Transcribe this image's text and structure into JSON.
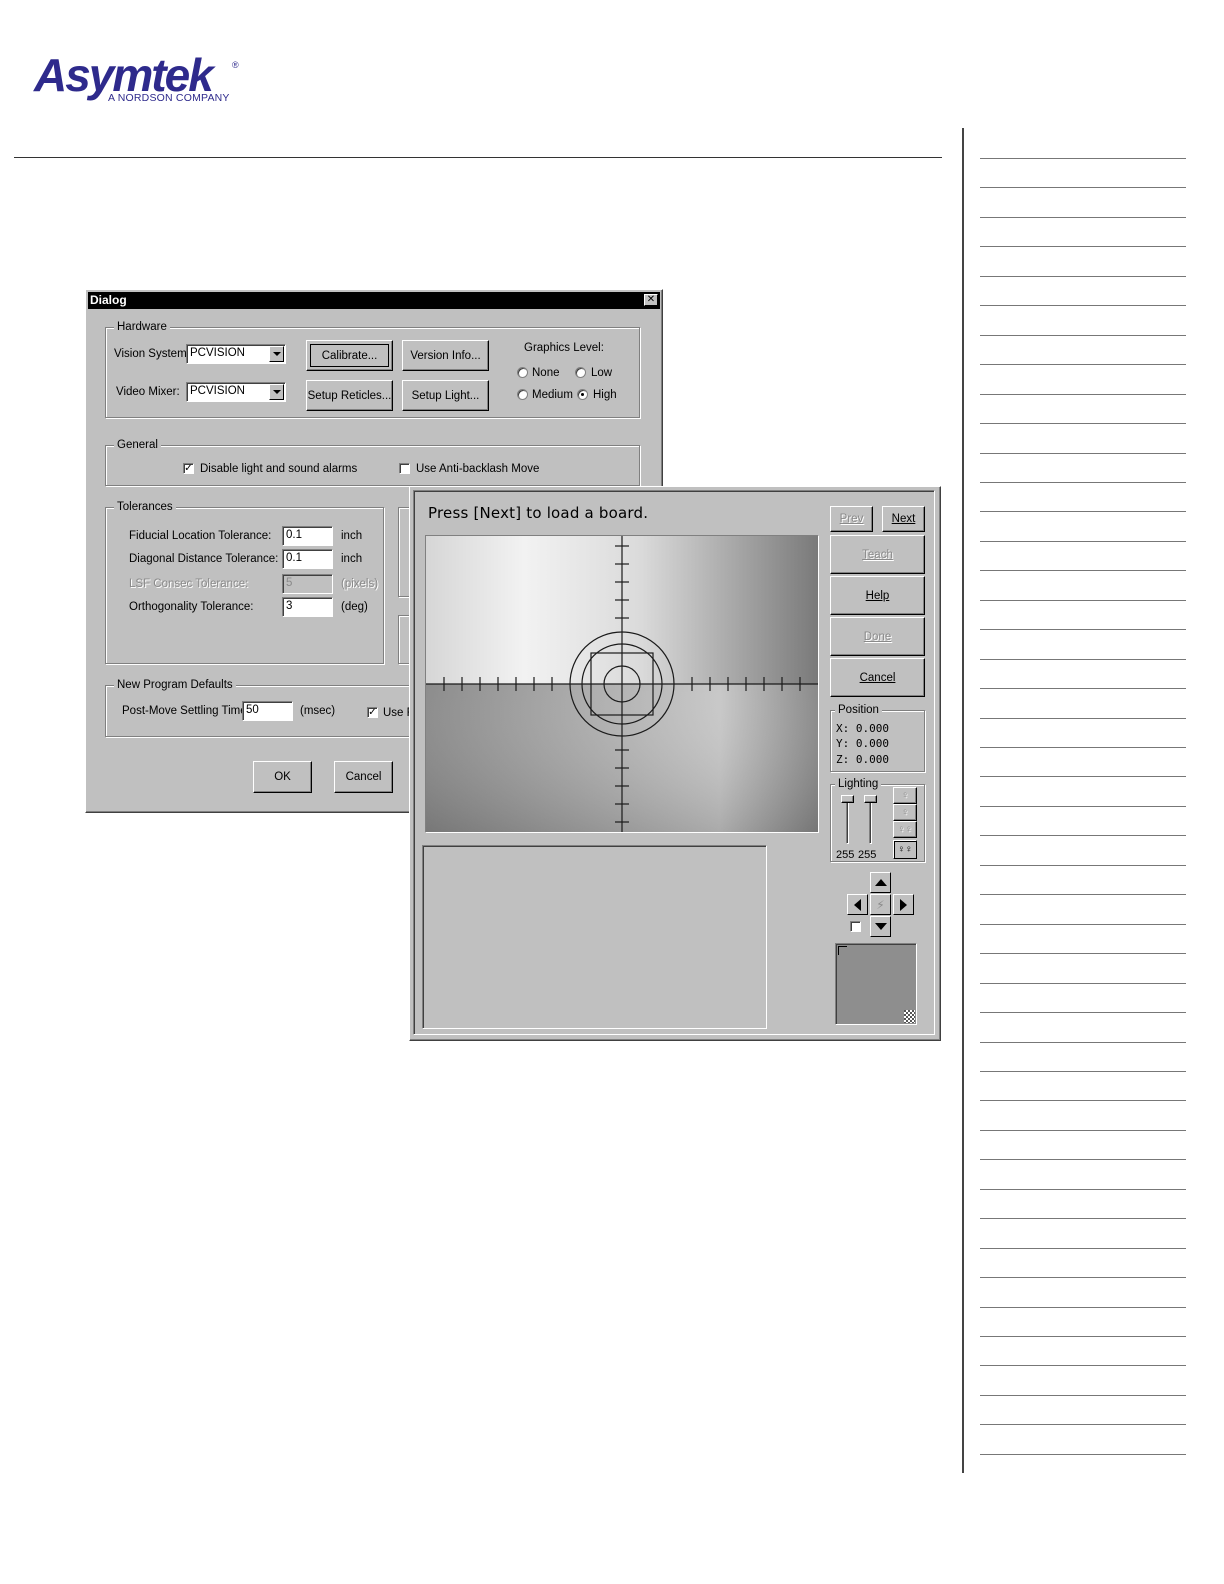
{
  "brand": {
    "name": "Asymtek",
    "registered": "®",
    "subtitle": "A NORDSON COMPANY",
    "color": "#2e2a8c"
  },
  "dialog": {
    "title": "Dialog",
    "hardware": {
      "label": "Hardware",
      "vision_system_label": "Vision System:",
      "vision_system_value": "PCVISION",
      "video_mixer_label": "Video Mixer:",
      "video_mixer_value": "PCVISION",
      "calibrate": "Calibrate...",
      "version_info": "Version Info...",
      "setup_reticles": "Setup Reticles...",
      "setup_light": "Setup Light...",
      "graphics_level_label": "Graphics Level:",
      "graphics_options": [
        "None",
        "Low",
        "Medium",
        "High"
      ],
      "graphics_selected": "High"
    },
    "general": {
      "label": "General",
      "disable_alarms": "Disable light and sound alarms",
      "disable_alarms_checked": true,
      "anti_backlash": "Use Anti-backlash Move",
      "anti_backlash_checked": false
    },
    "tolerances": {
      "label": "Tolerances",
      "rows": [
        {
          "label": "Fiducial Location Tolerance:",
          "value": "0.1",
          "unit": "inch",
          "enabled": true
        },
        {
          "label": "Diagonal Distance Tolerance:",
          "value": "0.1",
          "unit": "inch",
          "enabled": true
        },
        {
          "label": "LSF Consec Tolerance:",
          "value": "5",
          "unit": "(pixels)",
          "enabled": false
        },
        {
          "label": "Orthogonality Tolerance:",
          "value": "3",
          "unit": "(deg)",
          "enabled": true
        }
      ]
    },
    "defaults": {
      "label": "New Program Defaults",
      "settling_label": "Post-Move Settling Time:",
      "settling_value": "50",
      "settling_unit": "(msec)",
      "use_label": "Use F",
      "use_checked": true
    },
    "ok": "OK",
    "cancel": "Cancel"
  },
  "teach": {
    "prompt": "Press [Next] to load a board.",
    "buttons": {
      "prev": "Prev",
      "next": "Next",
      "teach": "Teach",
      "help": "Help",
      "done": "Done",
      "cancel": "Cancel"
    },
    "position": {
      "label": "Position",
      "x": "X:  0.000",
      "y": "Y:  0.000",
      "z": "Z:  0.000"
    },
    "lighting": {
      "label": "Lighting",
      "values": [
        "255",
        "255"
      ]
    }
  },
  "icons": [
    "close-icon",
    "dropdown-arrow-icon",
    "crosshair-reticle-icon",
    "light-bulb-icon",
    "arrow-up-icon",
    "arrow-down-icon",
    "arrow-left-icon",
    "arrow-right-icon",
    "center-icon"
  ]
}
